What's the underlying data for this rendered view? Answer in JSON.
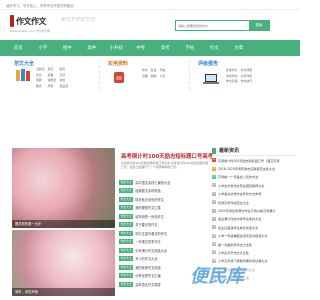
{
  "topbar": {
    "text": "读好学习，学开始上，学李学全华是学的题目"
  },
  "logo": {
    "brand": "作文作文",
    "sub": "www.zuowen.com 作文学习网",
    "slogan": "读作文学技写作"
  },
  "search": {
    "placeholder": "请输入想要搜索的作文",
    "button": "搜索"
  },
  "nav": {
    "items": [
      "首页",
      "小学",
      "初中",
      "高中",
      "小升初",
      "中考",
      "高考",
      "字帖",
      "作文",
      "文章"
    ]
  },
  "categories": [
    {
      "title": "范文大全",
      "links": [
        "记叙文",
        "游记",
        "描写",
        "议论",
        "叙事",
        "日记",
        "话题",
        "说明文",
        "书信",
        "散文",
        "抒情",
        "读后感"
      ]
    },
    {
      "title": "实用资料",
      "links": [
        "作文",
        "名言",
        "字帖",
        "诗歌",
        "题材",
        "大全"
      ]
    },
    {
      "title": "评级报告",
      "links": [
        "标准评分",
        "作文评级",
        "中考作文",
        "高考作文",
        "作文评语",
        "作文技巧"
      ]
    }
  ],
  "feature": {
    "headline": "高考倒计时100天励志短标题口号高考",
    "summary": "高考倒计时100天励志短标题口号高考 高考倒计时100天励志短标题口号，给自己加油打气一个简简单单的口号。",
    "photos": [
      {
        "caption": "樱花林的第一大步"
      },
      {
        "caption": "倾听，你的声音"
      }
    ],
    "list": [
      {
        "tag": "作文大全",
        "title": "高中语文素材汇编的大全"
      },
      {
        "tag": "作文大全",
        "title": "经典散文素材精选"
      },
      {
        "tag": "作文大全",
        "title": "描写秋天景色的作文"
      },
      {
        "tag": "作文大全",
        "title": "我的理想作文汇集"
      },
      {
        "tag": "作文大全",
        "title": "给妈妈的一封信作文"
      },
      {
        "tag": "作文大全",
        "title": "关于春天的作文"
      },
      {
        "tag": "作文大全",
        "title": "初中生描写春天的作文"
      },
      {
        "tag": "作文大全",
        "title": "一件难忘的事作文"
      },
      {
        "tag": "作文大全",
        "title": "中考满分作文精选大全"
      },
      {
        "tag": "作文大全",
        "title": "写人的作文大全"
      },
      {
        "tag": "作文大全",
        "title": "我的老师作文精选"
      },
      {
        "tag": "作文大全",
        "title": "中考优秀作文汇编"
      },
      {
        "tag": "作文大全",
        "title": "高考语文作文指导"
      }
    ]
  },
  "latest": {
    "title": "最新资讯",
    "items": [
      "高考倒计时100天励志短标题口号（面高高考",
      "2016-2020年青年励志演讲稿范文集大全",
      "高考前一个月备战二轮的方法",
      "小学生优秀作文范文题目推荐大全",
      "小学语文优秀作文写作方法参考",
      "优秀高考作文范文大全",
      "2020高考优秀满分作文示例以前高考满分",
      "语文满分作文中考作文素材大全",
      "班主任寄语学生成长的话大全",
      "小学一年级看图说话写话训练题大全",
      "第一次做家务作文大全集",
      "小学生写景作文大全集",
      "小学五年级下册数学期中测试卷大全",
      "初二数学期末复习资料大全",
      "初中语文复习资料汇编"
    ]
  },
  "watermark": "便民库",
  "colors": {
    "accent": "#48b07c",
    "headline": "#cc2b2b"
  }
}
